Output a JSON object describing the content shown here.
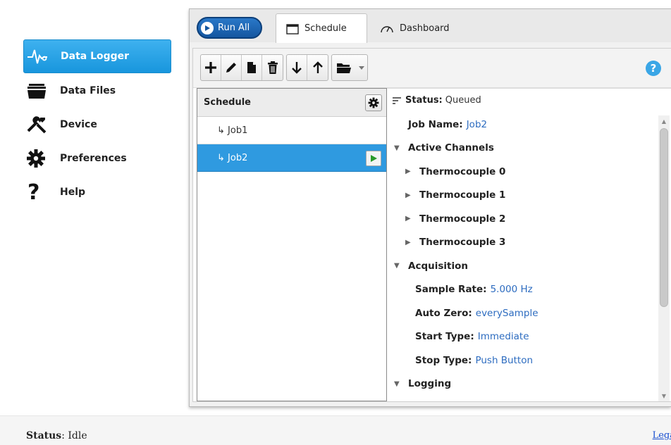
{
  "sidebar": {
    "items": [
      {
        "label": "Data Logger",
        "icon": "waveform-icon",
        "active": true
      },
      {
        "label": "Data Files",
        "icon": "files-icon"
      },
      {
        "label": "Device",
        "icon": "tools-icon"
      },
      {
        "label": "Preferences",
        "icon": "gear-icon"
      },
      {
        "label": "Help",
        "icon": "question-icon"
      }
    ]
  },
  "tabs": {
    "run_all": "Run All",
    "schedule": "Schedule",
    "dashboard": "Dashboard"
  },
  "toolbar": {
    "add": "add-icon",
    "edit": "edit-icon",
    "copy": "copy-icon",
    "delete": "trash-icon",
    "move_down": "arrow-down-icon",
    "move_up": "arrow-up-icon",
    "folder": "folder-icon",
    "help": "?"
  },
  "schedule": {
    "header": "Schedule",
    "jobs": [
      {
        "label": "↳ Job1",
        "selected": false
      },
      {
        "label": "↳ Job2",
        "selected": true
      }
    ]
  },
  "details": {
    "status_label": "Status:",
    "status_value": "Queued",
    "job_name_label": "Job Name:",
    "job_name_value": "Job2",
    "active_channels": "Active Channels",
    "channels": [
      "Thermocouple 0",
      "Thermocouple 1",
      "Thermocouple 2",
      "Thermocouple 3"
    ],
    "acquisition": "Acquisition",
    "sample_rate_label": "Sample Rate:",
    "sample_rate_value": "5.000 Hz",
    "auto_zero_label": "Auto Zero:",
    "auto_zero_value": "everySample",
    "start_type_label": "Start Type:",
    "start_type_value": "Immediate",
    "stop_type_label": "Stop Type:",
    "stop_type_value": "Push Button",
    "logging": "Logging"
  },
  "footer": {
    "status_label": "Status",
    "status_value": ": Idle",
    "legal": "Lega"
  },
  "colors": {
    "accent": "#2f9ae0",
    "run_all": "#1a63b0",
    "value_text": "#2d6cc0",
    "play_green": "#2a9a2a"
  }
}
